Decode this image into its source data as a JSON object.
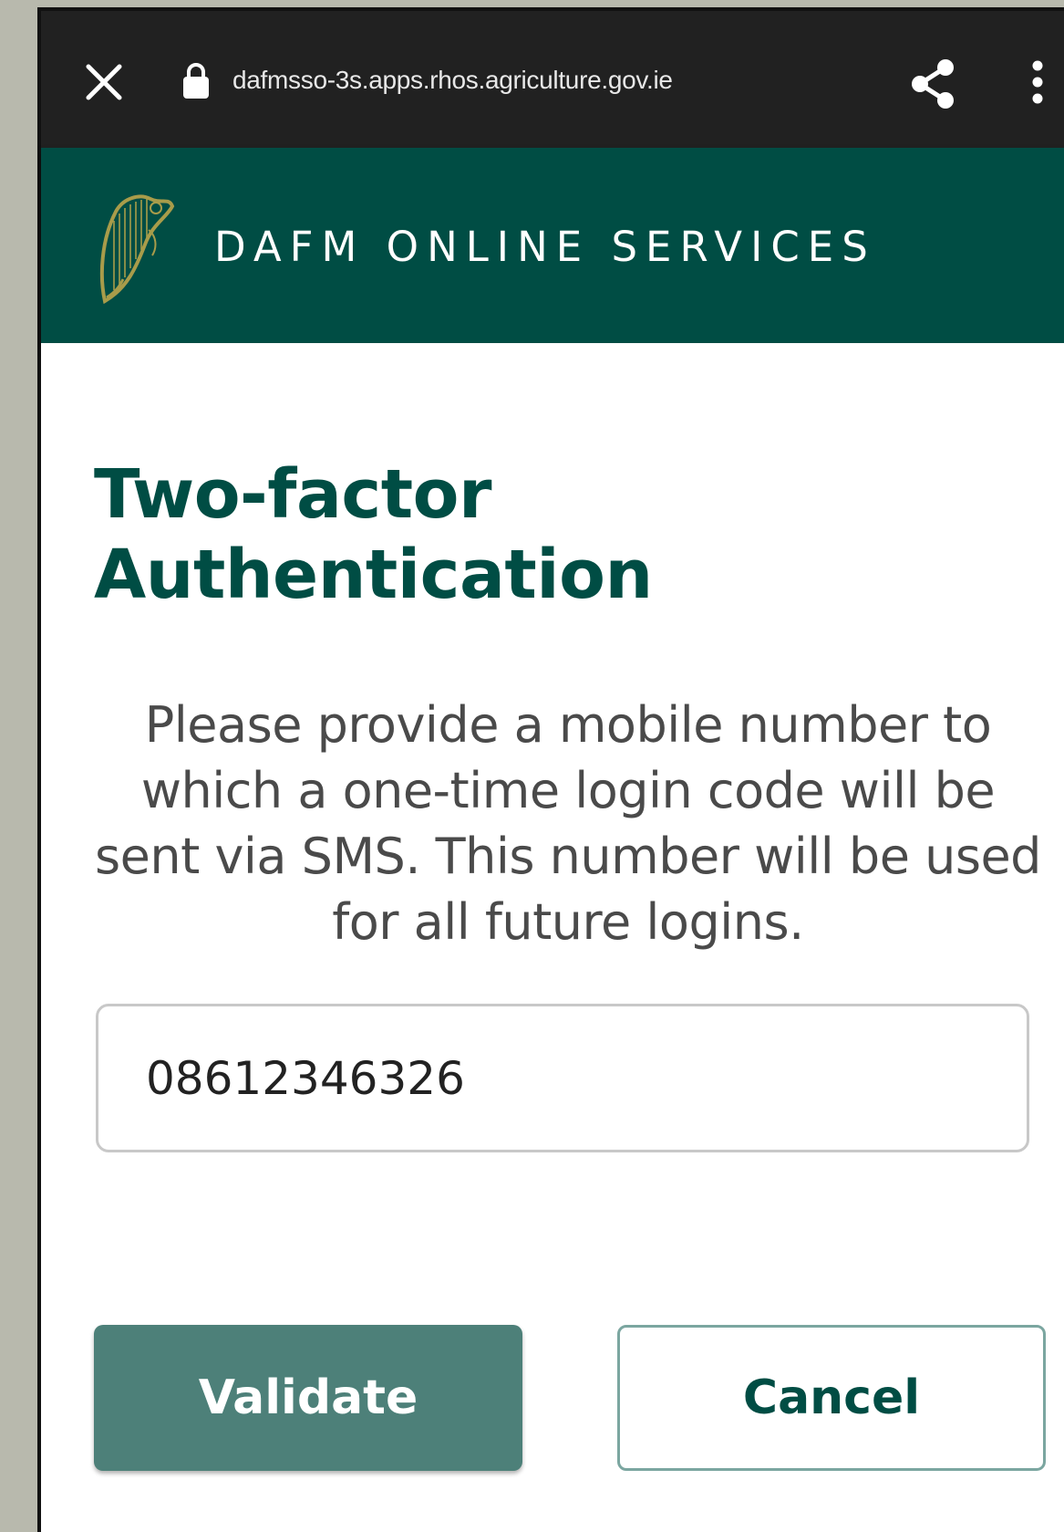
{
  "browser": {
    "url": "dafmsso-3s.apps.rhos.agriculture.gov.ie",
    "icons": {
      "close": "close-icon",
      "lock": "lock-icon",
      "share": "share-icon",
      "menu": "more-vert-icon"
    }
  },
  "header": {
    "title": "DAFM ONLINE SERVICES",
    "logo": "harp-logo-icon"
  },
  "main": {
    "title_line1": "Two-factor",
    "title_line2": "Authentication",
    "instructions": "Please provide a mobile number to which a one-time login code will be sent via SMS. This number will be used for all future logins.",
    "mobile_input": {
      "value": "08612346326"
    },
    "validate_label": "Validate",
    "cancel_label": "Cancel"
  },
  "colors": {
    "header_bg": "#004d44",
    "browser_bar_bg": "#212121",
    "primary_button": "#4d8079",
    "title_text": "#004d44"
  }
}
